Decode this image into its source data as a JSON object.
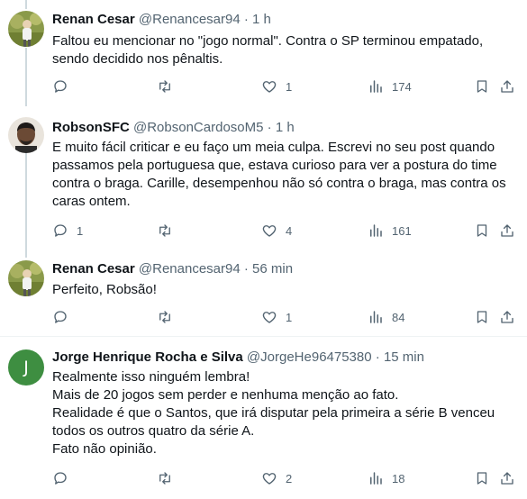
{
  "tweets": [
    {
      "name": "Renan Cesar",
      "handle": "@Renancesar94",
      "dot": "·",
      "time": "1 h",
      "lines": [
        "Faltou eu mencionar no \"jogo normal\". Contra o SP terminou empatado,",
        "sendo decidido nos pênaltis."
      ],
      "replies": "",
      "retweets": "",
      "likes": "1",
      "views": "174"
    },
    {
      "name": "RobsonSFC",
      "handle": "@RobsonCardosoM5",
      "dot": "·",
      "time": "1 h",
      "lines": [
        "E muito fácil criticar e eu faço um meia culpa. Escrevi no seu post quando",
        "passamos pela portuguesa que, estava curioso para ver a postura do time",
        "contra o braga. Carille, desempenhou não só contra o braga, mas contra os",
        "caras ontem."
      ],
      "replies": "1",
      "retweets": "",
      "likes": "4",
      "views": "161"
    },
    {
      "name": "Renan Cesar",
      "handle": "@Renancesar94",
      "dot": "·",
      "time": "56 min",
      "lines": [
        "Perfeito, Robsão!"
      ],
      "replies": "",
      "retweets": "",
      "likes": "1",
      "views": "84"
    },
    {
      "name": "Jorge Henrique Rocha e Silva",
      "handle": "@JorgeHe96475380",
      "dot": "·",
      "time": "15 min",
      "avatar_initial": "J",
      "lines": [
        "Realmente isso ninguém lembra!",
        "Mais de 20 jogos sem perder e nenhuma menção ao fato.",
        "Realidade é que o Santos, que irá disputar pela primeira a série B venceu",
        "todos os outros quatro da série A.",
        "Fato não opinião."
      ],
      "replies": "",
      "retweets": "",
      "likes": "2",
      "views": "18"
    }
  ],
  "colors": {
    "text": "#0f1419",
    "secondary": "#536471",
    "divider": "#eff3f4",
    "avatar_j": "#3e8e41"
  }
}
